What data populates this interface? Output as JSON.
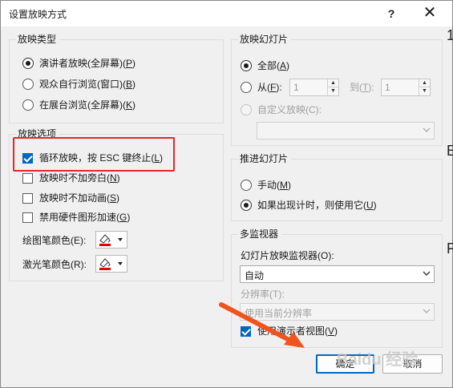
{
  "dialog": {
    "title": "设置放映方式",
    "help": "?",
    "close": "✕"
  },
  "show_type": {
    "title": "放映类型",
    "options": [
      {
        "label": "演讲者放映(全屏幕)(",
        "key": "P",
        "tail": ")",
        "checked": true
      },
      {
        "label": "观众自行浏览(窗口)(",
        "key": "B",
        "tail": ")",
        "checked": false
      },
      {
        "label": "在展台浏览(全屏幕)(",
        "key": "K",
        "tail": ")",
        "checked": false
      }
    ]
  },
  "show_options": {
    "title": "放映选项",
    "checkboxes": [
      {
        "label": "循环放映，按 ESC 键终止(",
        "key": "L",
        "tail": ")",
        "checked": true
      },
      {
        "label": "放映时不加旁白(",
        "key": "N",
        "tail": ")",
        "checked": false
      },
      {
        "label": "放映时不加动画(",
        "key": "S",
        "tail": ")",
        "checked": false
      },
      {
        "label": "禁用硬件图形加速(",
        "key": "G",
        "tail": ")",
        "checked": false
      }
    ],
    "pen_color_label": "绘图笔颜色(E):",
    "laser_color_label": "激光笔颜色(R):",
    "pen_color": "#e00000",
    "laser_color": "#e00000"
  },
  "slides": {
    "title": "放映幻灯片",
    "all_label": "全部(",
    "all_key": "A",
    "all_tail": ")",
    "from_label": "从(",
    "from_key": "F",
    "from_tail": "):",
    "from_value": "1",
    "to_label": "到(",
    "to_key": "T",
    "to_tail": "):",
    "to_value": "1",
    "custom_label": "自定义放映(C):",
    "custom_value": ""
  },
  "advance": {
    "title": "推进幻灯片",
    "manual_label": "手动(",
    "manual_key": "M",
    "manual_tail": ")",
    "timing_label": "如果出现计时，则使用它(",
    "timing_key": "U",
    "timing_tail": ")"
  },
  "monitors": {
    "title": "多监视器",
    "monitor_label": "幻灯片放映监视器(O):",
    "monitor_value": "自动",
    "resolution_label": "分辨率(T):",
    "resolution_value": "使用当前分辨率",
    "presenter_view_label": "使用演示者视图(",
    "presenter_view_key": "V",
    "presenter_view_tail": ")"
  },
  "buttons": {
    "ok": "确定",
    "cancel": "取消"
  },
  "background_glyphs": [
    "1",
    "E",
    "F"
  ],
  "watermark": "Baidu 经验",
  "colors": {
    "accent": "#0067c0",
    "highlight": "#e8252a",
    "arrow": "#f0531c"
  }
}
